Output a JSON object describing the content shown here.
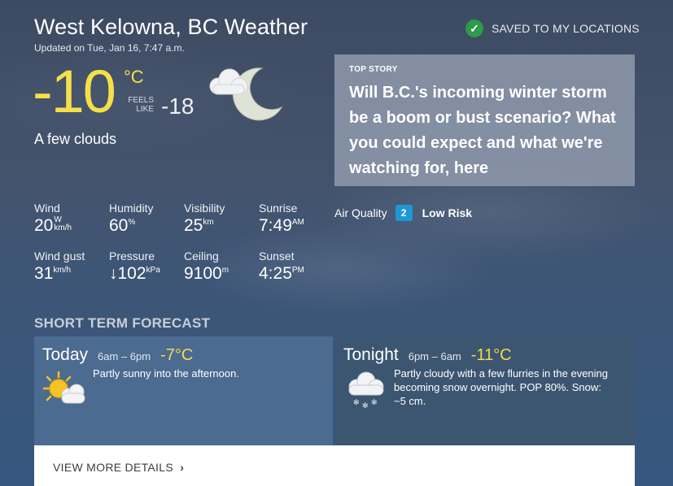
{
  "header": {
    "title": "West Kelowna, BC Weather",
    "updated": "Updated on Tue, Jan 16, 7:47 a.m.",
    "saved_label": "SAVED TO MY LOCATIONS",
    "saved_icon": "check-icon"
  },
  "current": {
    "temp": "-10",
    "unit": "°C",
    "feels_label_1": "FEELS",
    "feels_label_2": "LIKE",
    "feels_value": "-18",
    "condition": "A few clouds",
    "icon": "cloudy-moon-icon"
  },
  "top_story": {
    "label": "TOP STORY",
    "headline": "Will B.C.'s incoming winter storm be a boom or bust scenario? What you could expect and what we're watching for, here"
  },
  "metrics": {
    "wind": {
      "label": "Wind",
      "value": "20",
      "unit_top": "W",
      "unit_bottom": "km/h"
    },
    "humidity": {
      "label": "Humidity",
      "value": "60",
      "unit": "%"
    },
    "visibility": {
      "label": "Visibility",
      "value": "25",
      "unit": "km"
    },
    "sunrise": {
      "label": "Sunrise",
      "value": "7:49",
      "unit": "AM"
    },
    "wind_gust": {
      "label": "Wind gust",
      "value": "31",
      "unit": "km/h"
    },
    "pressure": {
      "label": "Pressure",
      "arrow": "↓",
      "value": "102",
      "unit": "kPa"
    },
    "ceiling": {
      "label": "Ceiling",
      "value": "9100",
      "unit": "m"
    },
    "sunset": {
      "label": "Sunset",
      "value": "4:25",
      "unit": "PM"
    }
  },
  "air_quality": {
    "label": "Air Quality",
    "index": "2",
    "risk": "Low Risk",
    "badge_color": "#1c98d8"
  },
  "forecast": {
    "section_title": "SHORT TERM FORECAST",
    "today": {
      "period": "Today",
      "time": "6am – 6pm",
      "temp": "-7°C",
      "desc": "Partly sunny into the afternoon.",
      "icon": "partly-sunny-icon"
    },
    "tonight": {
      "period": "Tonight",
      "time": "6pm – 6am",
      "temp": "-11°C",
      "desc": "Partly cloudy with a few flurries in the evening becoming snow overnight. POP 80%. Snow: ~5 cm.",
      "icon": "cloud-snow-icon"
    },
    "more_label": "VIEW MORE DETAILS",
    "more_icon": "chevron-right-icon"
  },
  "colors": {
    "accent_temp": "#f5e04a",
    "today_card": "#4b6b91",
    "tonight_card": "#3c5571",
    "saved_check": "#2e9a4a"
  }
}
